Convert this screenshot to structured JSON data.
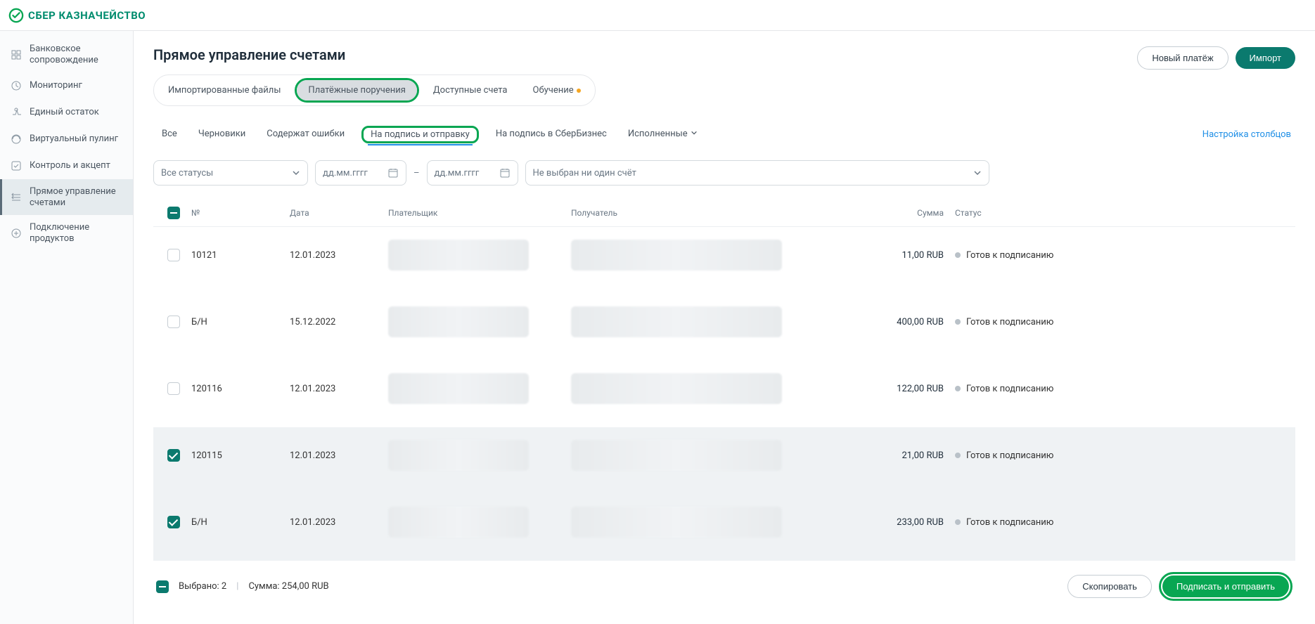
{
  "logo_text": "СБЕР КАЗНАЧЕЙСТВО",
  "sidebar": {
    "items": [
      {
        "label": "Банковское сопровождение"
      },
      {
        "label": "Мониторинг"
      },
      {
        "label": "Единый остаток"
      },
      {
        "label": "Виртуальный пулинг"
      },
      {
        "label": "Контроль и акцепт"
      },
      {
        "label": "Прямое управление счетами"
      },
      {
        "label": "Подключение продуктов"
      }
    ],
    "active_index": 5
  },
  "page": {
    "title": "Прямое управление счетами",
    "pill_tabs": [
      {
        "label": "Импортированные файлы"
      },
      {
        "label": "Платёжные поручения"
      },
      {
        "label": "Доступные счета"
      },
      {
        "label": "Обучение"
      }
    ],
    "pill_selected_index": 1,
    "learning_badge": true,
    "new_payment_label": "Новый платёж",
    "import_label": "Импорт",
    "subtabs": [
      {
        "label": "Все"
      },
      {
        "label": "Черновики"
      },
      {
        "label": "Содержат ошибки"
      },
      {
        "label": "На подпись и отправку"
      },
      {
        "label": "На подпись в СберБизнес"
      },
      {
        "label": "Исполненные",
        "caret": true
      }
    ],
    "subtab_active_index": 3,
    "columns_settings_label": "Настройка столбцов",
    "filters": {
      "status_label": "Все статусы",
      "date_placeholder": "дд.мм.гггг",
      "account_placeholder": "Не выбран ни один счёт"
    },
    "table": {
      "headers": {
        "num": "№",
        "date": "Дата",
        "payer": "Плательщик",
        "recv": "Получатель",
        "amount": "Сумма",
        "status": "Статус"
      },
      "rows": [
        {
          "checked": false,
          "num": "10121",
          "date": "12.01.2023",
          "amount": "11,00 RUB",
          "status": "Готов к подписанию"
        },
        {
          "checked": false,
          "num": "Б/Н",
          "date": "15.12.2022",
          "amount": "400,00 RUB",
          "status": "Готов к подписанию"
        },
        {
          "checked": false,
          "num": "120116",
          "date": "12.01.2023",
          "amount": "122,00 RUB",
          "status": "Готов к подписанию"
        },
        {
          "checked": true,
          "num": "120115",
          "date": "12.01.2023",
          "amount": "21,00 RUB",
          "status": "Готов к подписанию"
        },
        {
          "checked": true,
          "num": "Б/Н",
          "date": "12.01.2023",
          "amount": "233,00 RUB",
          "status": "Готов к подписанию"
        }
      ],
      "header_checkbox_state": "mixed"
    },
    "selection": {
      "selected_label": "Выбрано: 2",
      "sum_label": "Сумма: 254,00 RUB",
      "copy_label": "Скопировать",
      "sign_send_label": "Подписать и отправить"
    }
  }
}
